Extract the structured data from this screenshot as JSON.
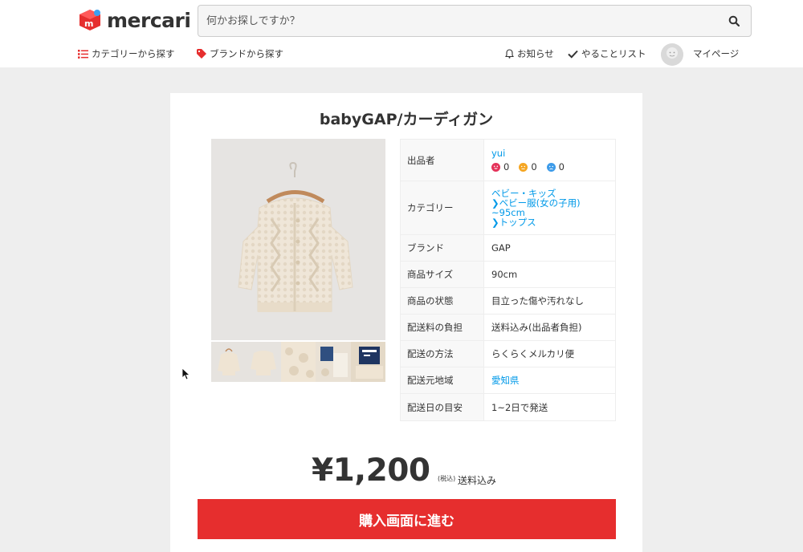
{
  "header": {
    "logo_text": "mercari",
    "search_placeholder": "何かお探しですか？",
    "nav": {
      "category": "カテゴリーから探す",
      "brand": "ブランドから探す",
      "notifications": "お知らせ",
      "todo": "やることリスト",
      "mypage": "マイページ"
    }
  },
  "item": {
    "title": "babyGAP/カーディガン",
    "seller_label": "出品者",
    "seller_name": "yui",
    "ratings": {
      "good": "0",
      "normal": "0",
      "bad": "0"
    },
    "category_label": "カテゴリー",
    "category_path": [
      "ベビー・キッズ",
      "ベビー服(女の子用)",
      "~95cm",
      "トップス"
    ],
    "brand_label": "ブランド",
    "brand": "GAP",
    "size_label": "商品サイズ",
    "size": "90cm",
    "condition_label": "商品の状態",
    "condition": "目立った傷や汚れなし",
    "shipping_fee_label": "配送料の負担",
    "shipping_fee": "送料込み(出品者負担)",
    "shipping_method_label": "配送の方法",
    "shipping_method": "らくらくメルカリ便",
    "ship_from_label": "配送元地域",
    "ship_from": "愛知県",
    "ship_days_label": "配送日の目安",
    "ship_days": "1~2日で発送",
    "price": "¥1,200",
    "tax_note": "(税込)",
    "shipping_included": "送料込み",
    "buy_button": "購入画面に進む"
  },
  "colors": {
    "brand_red": "#e62e2e",
    "link_blue": "#0099e8",
    "rating_good": "#e4335a",
    "rating_normal": "#f5a623",
    "rating_bad": "#3d9be9"
  }
}
